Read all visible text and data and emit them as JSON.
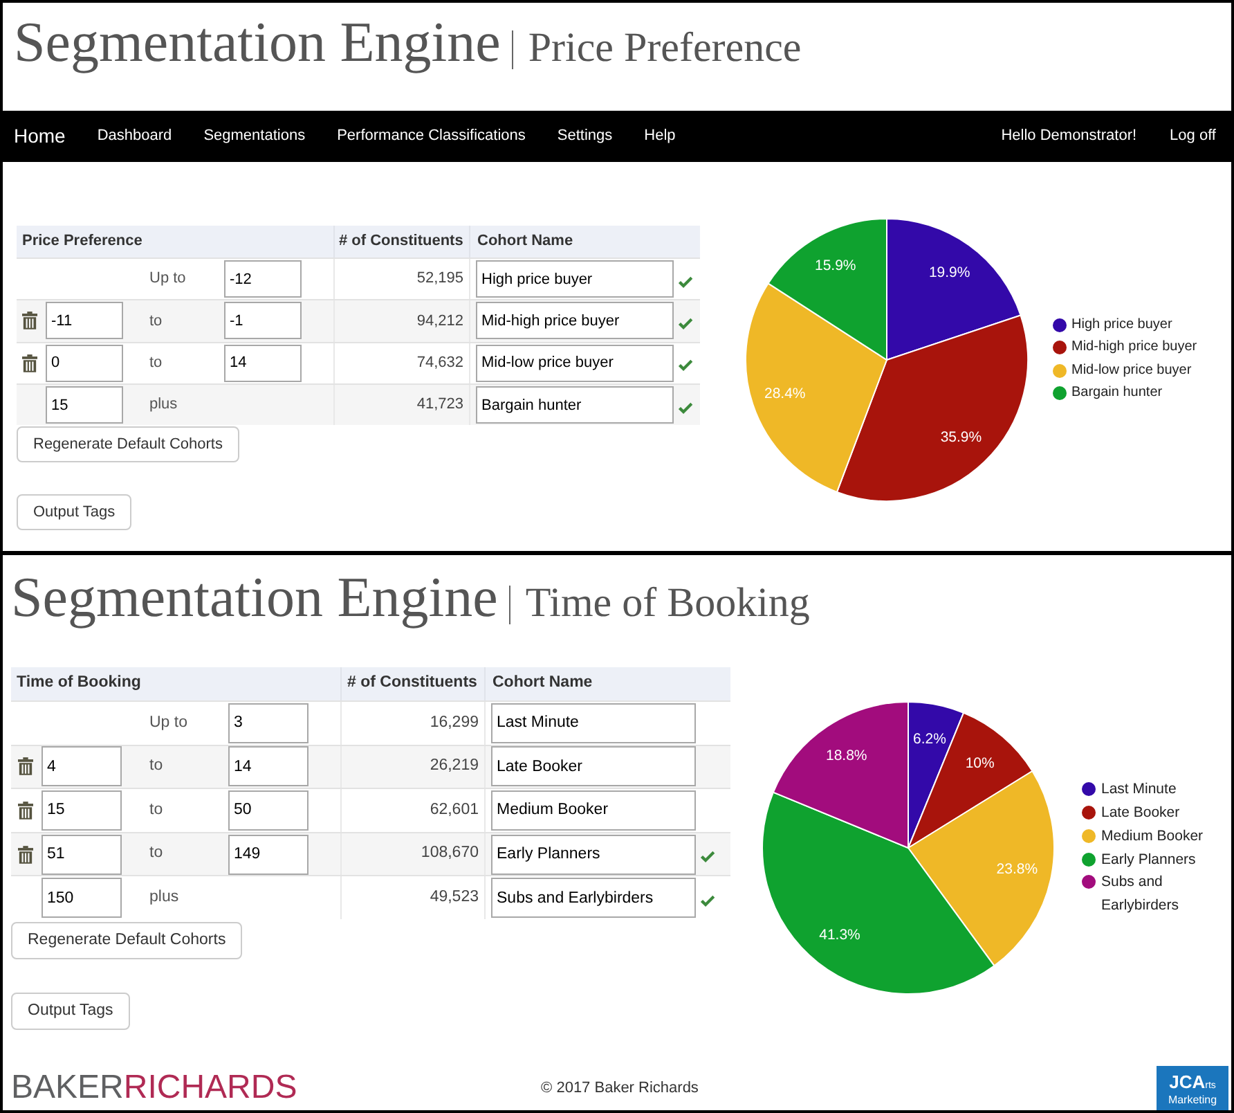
{
  "sections": [
    {
      "title": "Segmentation Engine",
      "subtitle": "Price Preference",
      "nav": {
        "home": "Home",
        "items": [
          "Dashboard",
          "Segmentations",
          "Performance Classifications",
          "Settings",
          "Help"
        ],
        "greeting": "Hello Demonstrator!",
        "logoff": "Log off"
      },
      "table": {
        "columns": [
          "Price Preference",
          "# of Constituents",
          "Cohort Name"
        ],
        "rows": [
          {
            "kind": "first",
            "connector": "Up to",
            "to": "-12",
            "constituents": "52,195",
            "cohort_name": "High price buyer",
            "valid": true
          },
          {
            "kind": "range",
            "from": "-11",
            "connector": "to",
            "to": "-1",
            "constituents": "94,212",
            "cohort_name": "Mid-high price buyer",
            "valid": true
          },
          {
            "kind": "range",
            "from": "0",
            "connector": "to",
            "to": "14",
            "constituents": "74,632",
            "cohort_name": "Mid-low price buyer",
            "valid": true
          },
          {
            "kind": "last",
            "from": "15",
            "connector": "plus",
            "constituents": "41,723",
            "cohort_name": "Bargain hunter",
            "valid": true
          }
        ]
      },
      "buttons": [
        "Regenerate Default Cohorts",
        "Output Tags"
      ],
      "chart_data": {
        "type": "pie",
        "categories": [
          "High price buyer",
          "Mid-high price buyer",
          "Mid-low price buyer",
          "Bargain hunter"
        ],
        "values": [
          19.9,
          35.9,
          28.4,
          15.9
        ],
        "value_labels": [
          "19.9%",
          "35.9%",
          "28.4%",
          "15.9%"
        ],
        "colors": [
          "#3309a9",
          "#a8140c",
          "#efb827",
          "#0fa22f"
        ],
        "legend": true
      }
    },
    {
      "title": "Segmentation Engine",
      "subtitle": "Time of Booking",
      "table": {
        "columns": [
          "Time of Booking",
          "# of Constituents",
          "Cohort Name"
        ],
        "rows": [
          {
            "kind": "first",
            "connector": "Up to",
            "to": "3",
            "constituents": "16,299",
            "cohort_name": "Last Minute",
            "valid": false
          },
          {
            "kind": "range",
            "from": "4",
            "connector": "to",
            "to": "14",
            "constituents": "26,219",
            "cohort_name": "Late Booker",
            "valid": false
          },
          {
            "kind": "range",
            "from": "15",
            "connector": "to",
            "to": "50",
            "constituents": "62,601",
            "cohort_name": "Medium Booker",
            "valid": false
          },
          {
            "kind": "range",
            "from": "51",
            "connector": "to",
            "to": "149",
            "constituents": "108,670",
            "cohort_name": "Early Planners",
            "valid": true
          },
          {
            "kind": "last",
            "from": "150",
            "connector": "plus",
            "constituents": "49,523",
            "cohort_name": "Subs and Earlybirders",
            "valid": true
          }
        ]
      },
      "buttons": [
        "Regenerate Default Cohorts",
        "Output Tags"
      ],
      "chart_data": {
        "type": "pie",
        "categories": [
          "Last Minute",
          "Late Booker",
          "Medium Booker",
          "Early Planners",
          "Subs and Earlybirders"
        ],
        "values": [
          6.2,
          10,
          23.8,
          41.3,
          18.8
        ],
        "value_labels": [
          "6.2%",
          "10%",
          "23.8%",
          "41.3%",
          "18.8%"
        ],
        "colors": [
          "#3309a9",
          "#a8140c",
          "#efb827",
          "#0fa22f",
          "#a20c7d"
        ],
        "legend": true
      }
    }
  ],
  "footer": {
    "logo_left": [
      "BAKER",
      "RICHARDS"
    ],
    "copyright": "© 2017 Baker Richards",
    "logo_right": {
      "main": "JCA",
      "suffix": "rts",
      "line_2": "Marketing"
    }
  }
}
